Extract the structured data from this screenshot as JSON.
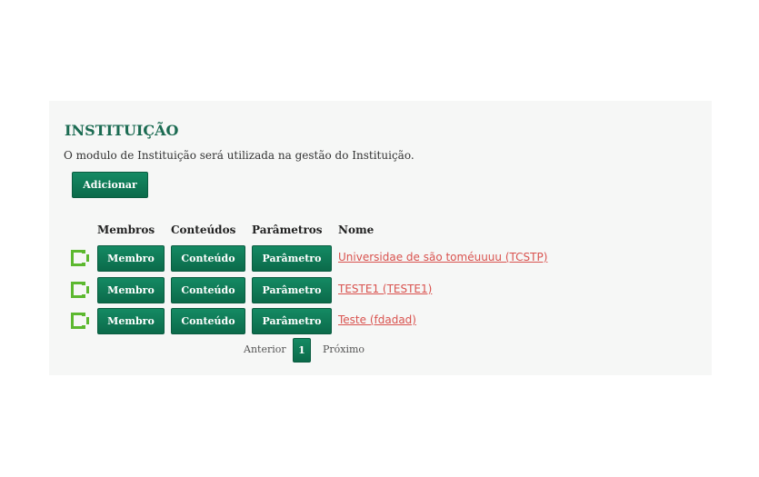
{
  "page": {
    "title": "INSTITUIÇÃO",
    "description": "O modulo de Instituição será utilizada na gestão do Instituição."
  },
  "actions": {
    "add_label": "Adicionar"
  },
  "table": {
    "headers": [
      "Membros",
      "Conteúdos",
      "Parâmetros",
      "Nome"
    ],
    "rows": [
      {
        "membro_label": "Membro",
        "conteudo_label": "Conteúdo",
        "parametro_label": "Parâmetro",
        "name": "Universidae de são toméuuuu (TCSTP)"
      },
      {
        "membro_label": "Membro",
        "conteudo_label": "Conteúdo",
        "parametro_label": "Parâmetro",
        "name": "TESTE1 (TESTE1)"
      },
      {
        "membro_label": "Membro",
        "conteudo_label": "Conteúdo",
        "parametro_label": "Parâmetro",
        "name": "Teste (fdadad)"
      }
    ],
    "row_icon": "edit-frame-icon"
  },
  "pagination": {
    "prev_label": "Anterior",
    "current_page": "1",
    "next_label": "Próximo"
  },
  "colors": {
    "accent": "#148a63",
    "title": "#1b6b52",
    "link": "#d9534f",
    "icon": "#5cb82f"
  }
}
